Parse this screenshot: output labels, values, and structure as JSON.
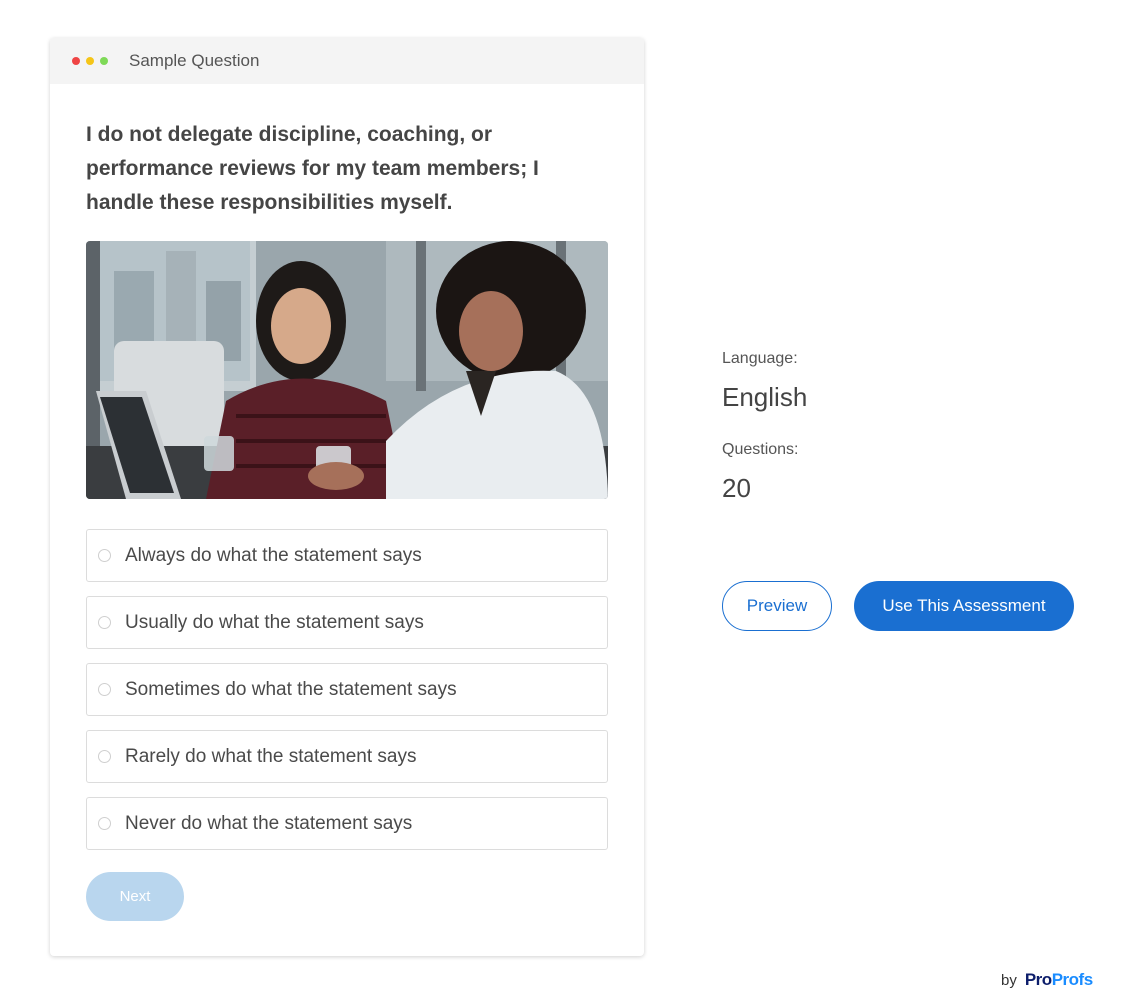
{
  "card": {
    "title": "Sample Question",
    "dot_colors": [
      "#ef4444",
      "#f5c518",
      "#7ed957"
    ]
  },
  "question": {
    "text": "I do not delegate discipline, coaching, or performance reviews for my team members; I handle these responsibilities myself."
  },
  "options": [
    {
      "label": "Always do what the statement says"
    },
    {
      "label": "Usually do what the statement says"
    },
    {
      "label": "Sometimes do what the statement says"
    },
    {
      "label": "Rarely do what the statement says"
    },
    {
      "label": "Never do what the statement says"
    }
  ],
  "next_label": "Next",
  "meta": {
    "language_label": "Language:",
    "language_value": "English",
    "questions_label": "Questions:",
    "questions_value": "20"
  },
  "actions": {
    "preview_label": "Preview",
    "use_label": "Use This Assessment"
  },
  "brand": {
    "by": "by",
    "pro": "Pro",
    "profs": "Profs"
  },
  "colors": {
    "accent": "#1a6fd1",
    "next_disabled": "#b9d6ee"
  }
}
